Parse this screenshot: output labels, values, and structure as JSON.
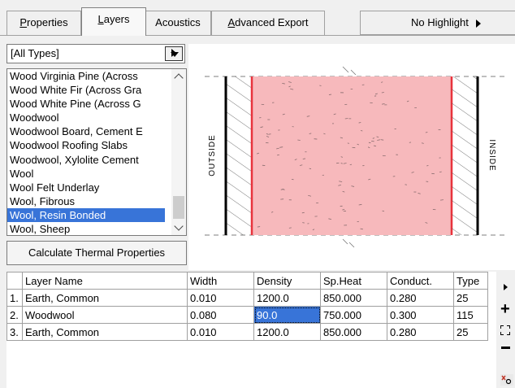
{
  "tabs": [
    {
      "label": "Properties",
      "mnemonic": "P",
      "rest": "roperties",
      "active": false
    },
    {
      "label": "Layers",
      "mnemonic": "L",
      "rest": "ayers",
      "active": true
    },
    {
      "label": "Acoustics",
      "mnemonic": "",
      "rest": "Acoustics",
      "active": false
    },
    {
      "label": "Advanced Export",
      "mnemonic": "A",
      "rest": "dvanced Export",
      "active": false
    }
  ],
  "highlight_button": {
    "label": "No Highlight",
    "prefix": "No Hi",
    "mnemonic": "g",
    "suffix": "hlight"
  },
  "type_filter": {
    "value": "[All Types]"
  },
  "materials": {
    "items": [
      "Wood Virginia Pine (Across",
      "Wood White Fir (Across Gra",
      "Wood White Pine (Across G",
      "Woodwool",
      "Woodwool Board, Cement E",
      "Woodwool Roofing Slabs",
      "Woodwool, Xylolite Cement",
      "Wool",
      "Wool Felt Underlay",
      "Wool, Fibrous",
      "Wool, Resin Bonded",
      "Wool, Sheep"
    ],
    "selected_index": 10
  },
  "calculate_button": {
    "label": "Calculate Thermal Properties"
  },
  "preview": {
    "outside_label": "OUTSIDE",
    "inside_label": "INSIDE",
    "fill_color": "#f7b9bc",
    "edge_color": "#e8333c"
  },
  "table": {
    "columns": [
      "",
      "Layer Name",
      "Width",
      "Density",
      "Sp.Heat",
      "Conduct.",
      "Type"
    ],
    "rows": [
      [
        "1.",
        "Earth, Common",
        "0.010",
        "1200.0",
        "850.000",
        "0.280",
        "25"
      ],
      [
        "2.",
        "Woodwool",
        "0.080",
        "90.0",
        "750.000",
        "0.300",
        "115"
      ],
      [
        "3.",
        "Earth, Common",
        "0.010",
        "1200.0",
        "850.000",
        "0.280",
        "25"
      ]
    ],
    "selected_cell": {
      "row": 1,
      "col": 3
    }
  },
  "toolbar_icons": [
    "menu-arrow-icon",
    "add-layer-icon",
    "expand-icon",
    "remove-layer-icon",
    "cut-icon"
  ]
}
